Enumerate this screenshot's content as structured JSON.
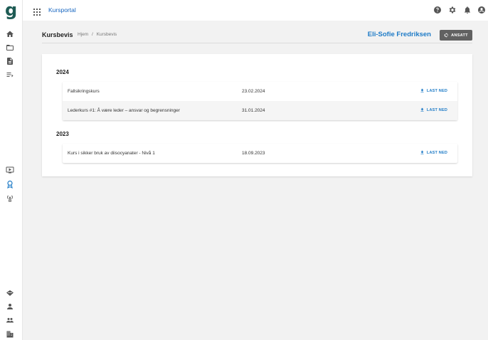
{
  "sidebar": {
    "logo": "g",
    "icons": [
      "home-icon",
      "folder-icon",
      "document-icon",
      "list-icon",
      "monitor-icon",
      "certificate-icon",
      "broadcast-icon",
      "diamond-icon",
      "person-icon",
      "group-icon",
      "building-icon"
    ],
    "active_icon": "certificate-icon"
  },
  "topbar": {
    "app_title": "Kursportal",
    "icons": [
      "help-icon",
      "settings-icon",
      "bell-icon",
      "account-icon"
    ]
  },
  "header": {
    "title": "Kursbevis",
    "breadcrumb": [
      "Hjem",
      "/",
      "Kursbevis"
    ],
    "user_name": "Eli-Sofie Fredriksen",
    "employee_button": "ANSATT"
  },
  "certificates": {
    "download_label": "LAST NED",
    "groups": [
      {
        "year": "2024",
        "courses": [
          {
            "name": "Fallsikringskurs",
            "date": "23.02.2024"
          },
          {
            "name": "Lederkurs #1: Å være leder – ansvar og begrensninger",
            "date": "31.01.2024"
          }
        ]
      },
      {
        "year": "2023",
        "courses": [
          {
            "name": "Kurs i sikker bruk av diisocyanater - Nivå 1",
            "date": "18.09.2023"
          }
        ]
      }
    ]
  },
  "colors": {
    "accent": "#1e7bc7",
    "brand": "#1e5b54",
    "button_bg": "#616161"
  }
}
